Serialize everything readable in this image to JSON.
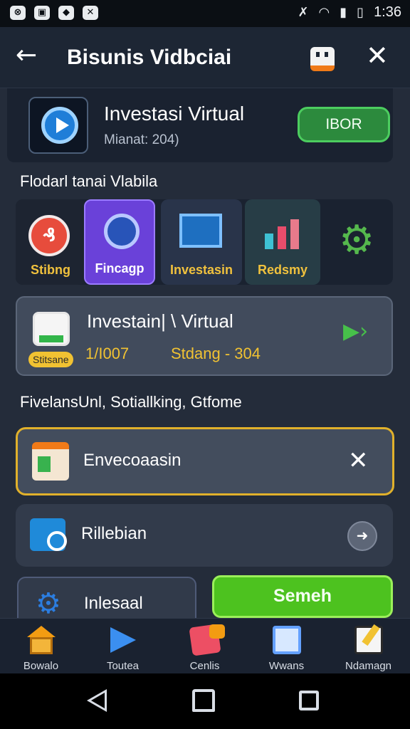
{
  "status_bar": {
    "left_icons": [
      "app-icon-1",
      "app-icon-2",
      "app-icon-3",
      "app-icon-4"
    ],
    "right_icons": [
      "mute-icon",
      "wifi-icon",
      "signal-icon",
      "battery-icon"
    ],
    "time": "1:36"
  },
  "header": {
    "title": "Bisunis Vidbciai",
    "icons": [
      "back-arrow-icon",
      "briefcase-icon",
      "close-icon"
    ]
  },
  "hero": {
    "title": "Investasi Virtual",
    "subtitle": "Mianat: 204)",
    "button_label": "IBOR"
  },
  "sections": {
    "categories_title": "Flodarl tanai Vlabila",
    "list_title": "FivelansUnl, Sotiallking, Gtfome"
  },
  "categories": [
    {
      "label": "Stibng"
    },
    {
      "label": "Fincagp"
    },
    {
      "label": "Investasin"
    },
    {
      "label": "Redsmy"
    },
    {
      "label": ""
    }
  ],
  "promo": {
    "title": "Investain| \\ Virtual",
    "badge": "Stitsane",
    "left_value": "1/I007",
    "right_value": "Stdang - 304"
  },
  "list_items": [
    {
      "label": "Envecoaasin"
    },
    {
      "label": "Rillebian"
    }
  ],
  "bottom_actions": {
    "inlay_label": "Inlesaal",
    "search_label": "Semeh"
  },
  "bottom_nav": [
    {
      "label": "Bowalo"
    },
    {
      "label": "Toutea"
    },
    {
      "label": "Cenlis"
    },
    {
      "label": "Wwans"
    },
    {
      "label": "Ndamagn"
    }
  ],
  "colors": {
    "accent_green": "#4dc21f",
    "accent_yellow": "#f1c232",
    "accent_purple": "#6a41d9",
    "background": "#242c3a"
  }
}
